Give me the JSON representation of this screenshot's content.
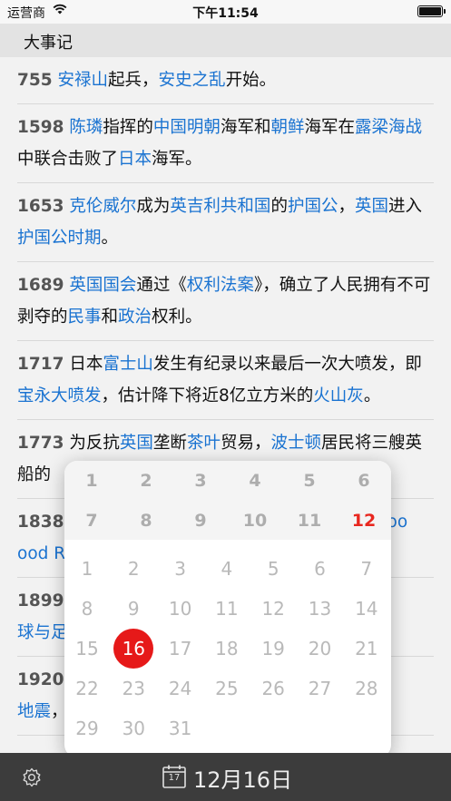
{
  "status_bar": {
    "carrier": "运营商",
    "time": "下午11:54"
  },
  "section_header": {
    "title": "大事记"
  },
  "events": [
    {
      "year": "755",
      "parts": [
        [
          "l",
          "安禄山"
        ],
        [
          "t",
          "起兵，"
        ],
        [
          "l",
          "安史之乱"
        ],
        [
          "t",
          "开始。"
        ]
      ]
    },
    {
      "year": "1598",
      "parts": [
        [
          "l",
          "陈璘"
        ],
        [
          "t",
          "指挥的"
        ],
        [
          "l",
          "中国明朝"
        ],
        [
          "t",
          "海军和"
        ],
        [
          "l",
          "朝鲜"
        ],
        [
          "t",
          "海军在"
        ],
        [
          "l",
          "露梁海战"
        ],
        [
          "t",
          "中联合击败了"
        ],
        [
          "l",
          "日本"
        ],
        [
          "t",
          "海军。"
        ]
      ]
    },
    {
      "year": "1653",
      "parts": [
        [
          "l",
          "克伦威尔"
        ],
        [
          "t",
          "成为"
        ],
        [
          "l",
          "英吉利共和国"
        ],
        [
          "t",
          "的"
        ],
        [
          "l",
          "护国公"
        ],
        [
          "t",
          "，"
        ],
        [
          "l",
          "英国"
        ],
        [
          "t",
          "进入"
        ],
        [
          "l",
          "护国公时期"
        ],
        [
          "t",
          "。"
        ]
      ]
    },
    {
      "year": "1689",
      "parts": [
        [
          "l",
          "英国国会"
        ],
        [
          "t",
          "通过《"
        ],
        [
          "l",
          "权利法案"
        ],
        [
          "t",
          "》，确立了人民拥有不可剥夺的"
        ],
        [
          "l",
          "民事"
        ],
        [
          "t",
          "和"
        ],
        [
          "l",
          "政治"
        ],
        [
          "t",
          "权利。"
        ]
      ]
    },
    {
      "year": "1717",
      "parts": [
        [
          "t",
          "日本"
        ],
        [
          "l",
          "富士山"
        ],
        [
          "t",
          "发生有纪录以来最后一次大喷发，即"
        ],
        [
          "l",
          "宝永大喷发"
        ],
        [
          "t",
          "，估计降下将近8亿立方米的"
        ],
        [
          "l",
          "火山灰"
        ],
        [
          "t",
          "。"
        ]
      ]
    },
    {
      "year": "1773",
      "parts": [
        [
          "t",
          "为反抗"
        ],
        [
          "l",
          "英国"
        ],
        [
          "t",
          "垄断"
        ],
        [
          "l",
          "茶叶"
        ],
        [
          "t",
          "贸易，"
        ],
        [
          "l",
          "波士顿"
        ],
        [
          "t",
          "居民将三艘英船的"
        ]
      ]
    },
    {
      "year": "1838",
      "parts": [
        [
          "t",
          "　　　　　　　　　　　　　　　　　 （"
        ],
        [
          "l",
          "Voo"
        ],
        [
          "t",
          "　　　　　　　　　　　　　　　　"
        ],
        [
          "l",
          "ood River"
        ],
        [
          "t",
          "）"
        ]
      ]
    },
    {
      "year": "1899",
      "parts": [
        [
          "t",
          "　　　　　　　　　　　　　　　　　　　　　　"
        ],
        [
          "l",
          "球与足球俱"
        ]
      ]
    },
    {
      "year": "1920",
      "parts": [
        [
          "t",
          "　　　　　　　　　　　　　　　　　　　　　　"
        ],
        [
          "l",
          "地震"
        ],
        [
          "t",
          "，2"
        ]
      ]
    }
  ],
  "calendar": {
    "months_row1": [
      "1",
      "2",
      "3",
      "4",
      "5",
      "6"
    ],
    "months_row2": [
      "7",
      "8",
      "9",
      "10",
      "11",
      "12"
    ],
    "selected_month": "12",
    "days": [
      [
        "1",
        "2",
        "3",
        "4",
        "5",
        "6",
        "7"
      ],
      [
        "8",
        "9",
        "10",
        "11",
        "12",
        "13",
        "14"
      ],
      [
        "15",
        "16",
        "17",
        "18",
        "19",
        "20",
        "21"
      ],
      [
        "22",
        "23",
        "24",
        "25",
        "26",
        "27",
        "28"
      ],
      [
        "29",
        "30",
        "31"
      ]
    ],
    "selected_day": "16"
  },
  "toolbar": {
    "calendar_icon_day": "17",
    "date_label": "12月16日"
  },
  "colors": {
    "link": "#1a73d1",
    "accent_red": "#e61919",
    "toolbar_bg": "#3c3c3c"
  }
}
